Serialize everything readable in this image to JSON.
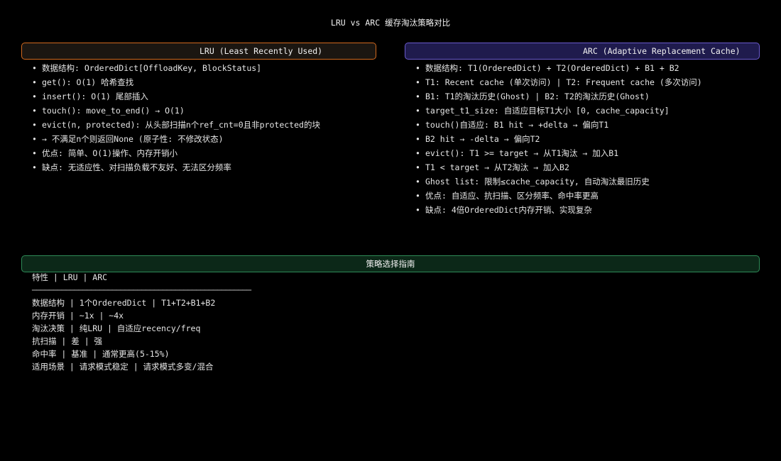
{
  "title": "LRU vs ARC 缓存淘汰策略对比",
  "lru": {
    "header": "LRU (Least Recently Used)",
    "items": [
      "数据结构: OrderedDict[OffloadKey, BlockStatus]",
      "get(): O(1) 哈希查找",
      "insert(): O(1) 尾部插入",
      "touch(): move_to_end() → O(1)",
      "evict(n, protected): 从头部扫描n个ref_cnt=0且非protected的块",
      "→ 不满足n个则返回None (原子性: 不修改状态)",
      "优点: 简单、O(1)操作、内存开销小",
      "缺点: 无适应性、对扫描负载不友好、无法区分频率"
    ]
  },
  "arc": {
    "header": "ARC (Adaptive Replacement Cache)",
    "items": [
      "数据结构: T1(OrderedDict) + T2(OrderedDict) + B1 + B2",
      "T1: Recent cache (单次访问) | T2: Frequent cache (多次访问)",
      "B1: T1的淘汰历史(Ghost) | B2: T2的淘汰历史(Ghost)",
      "target_t1_size: 自适应目标T1大小 [0, cache_capacity]",
      "touch()自适应: B1 hit → +delta → 偏向T1",
      "B2 hit → -delta → 偏向T2",
      "evict(): T1 >= target → 从T1淘汰 → 加入B1",
      "T1 < target → 从T2淘汰 → 加入B2",
      "Ghost list: 限制≤cache_capacity, 自动淘汰最旧历史",
      "优点: 自适应、抗扫描、区分频率、命中率更高",
      "缺点: 4倍OrderedDict内存开销、实现复杂"
    ]
  },
  "guide": {
    "header": "策略选择指南",
    "table_header": "特性 | LRU | ARC",
    "separator": "────────────────────────────────────────────────────",
    "rows": [
      "数据结构 | 1个OrderedDict | T1+T2+B1+B2",
      "内存开销 | ~1x | ~4x",
      "淘汰决策 | 纯LRU | 自适应recency/freq",
      "抗扫描 | 差 | 强",
      "命中率 | 基准 | 通常更高(5-15%)",
      "适用场景 | 请求模式稳定 | 请求模式多变/混合"
    ]
  },
  "colors": {
    "lru_border": "#d2691e",
    "arc_border": "#6a5acd",
    "guide_border": "#2e8b57"
  }
}
